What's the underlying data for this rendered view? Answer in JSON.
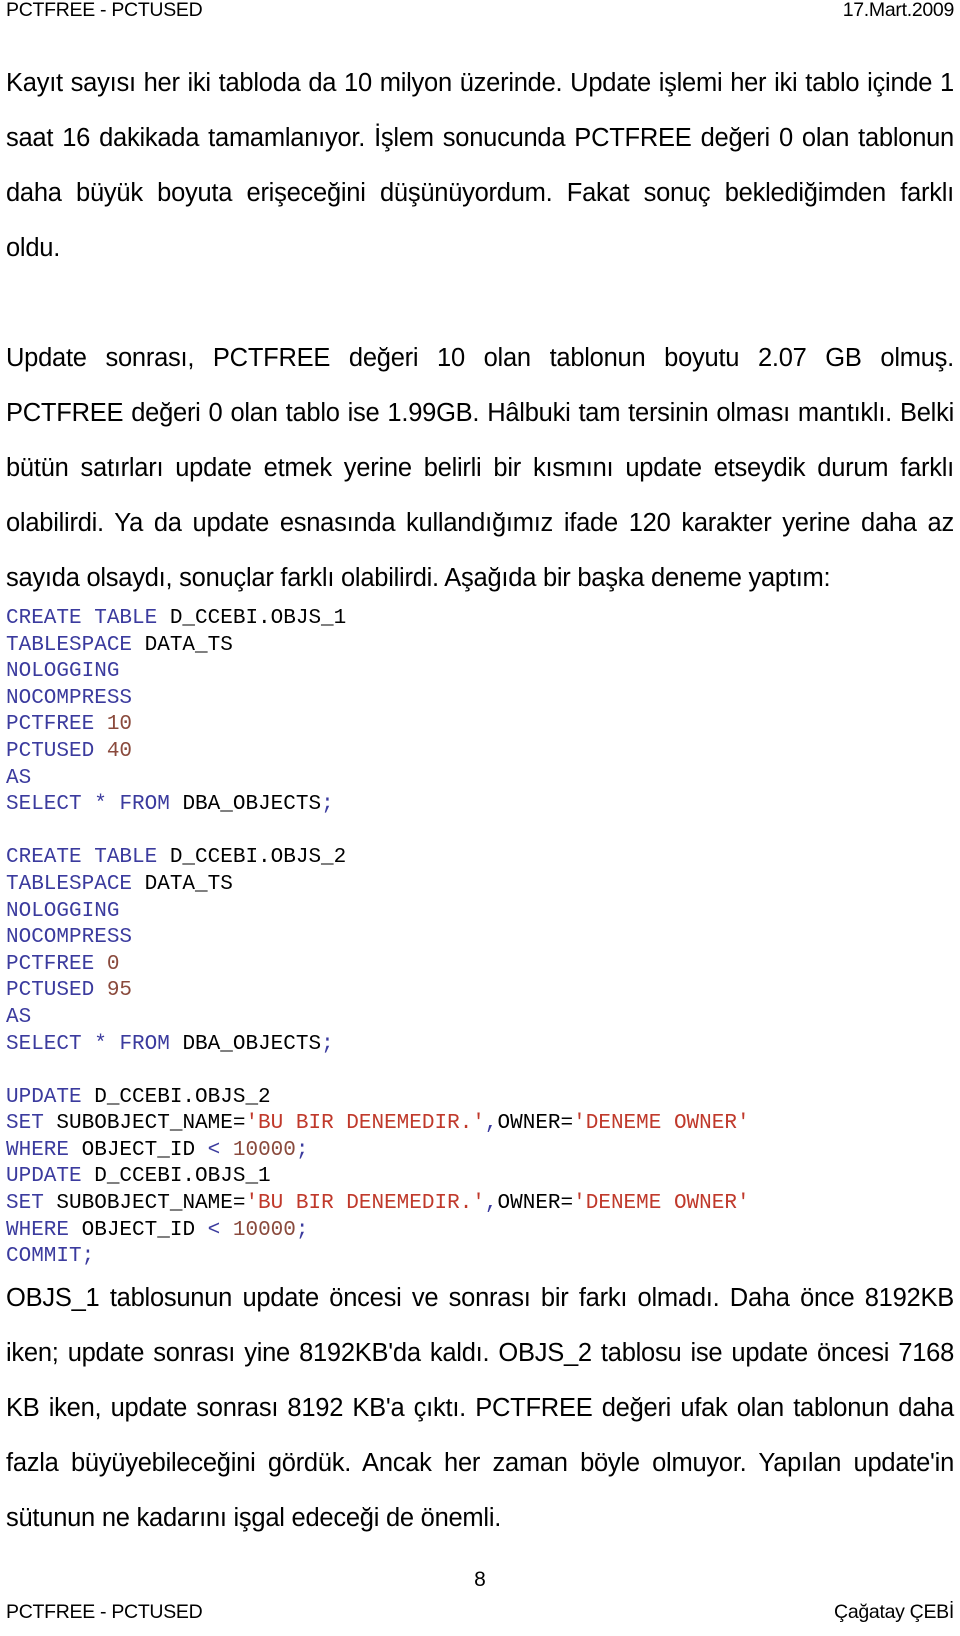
{
  "header": {
    "left": "PCTFREE - PCTUSED",
    "right": "17.Mart.2009"
  },
  "body": {
    "paragraph_1": "Kayıt sayısı her iki tabloda da 10 milyon üzerinde. Update işlemi her iki tablo içinde 1 saat 16 dakikada tamamlanıyor. İşlem sonucunda PCTFREE değeri 0 olan tablonun daha büyük boyuta erişeceğini düşünüyordum. Fakat sonuç beklediğimden farklı oldu.",
    "paragraph_2": "Update sonrası, PCTFREE değeri 10 olan tablonun boyutu 2.07 GB olmuş. PCTFREE değeri 0 olan tablo ise 1.99GB. Hâlbuki tam tersinin olması mantıklı. Belki bütün satırları update etmek yerine belirli bir kısmını update etseydik durum farklı olabilirdi.  Ya da update esnasında kullandığımız ifade 120 karakter yerine daha az sayıda olsaydı, sonuçlar farklı olabilirdi.  Aşağıda bir başka deneme yaptım:",
    "paragraph_3": "OBJS_1 tablosunun update öncesi ve sonrası bir farkı olmadı. Daha önce 8192KB iken; update sonrası yine 8192KB'da kaldı. OBJS_2 tablosu ise update öncesi 7168 KB iken, update sonrası 8192 KB'a çıktı. PCTFREE değeri ufak olan tablonun daha fazla büyüyebileceğini gördük. Ancak her zaman böyle olmuyor. Yapılan update'in sütunun ne kadarını işgal edeceği de önemli."
  },
  "code": {
    "language": "sql",
    "colors": {
      "keyword": "#3b3b9e",
      "number": "#8a4a3c",
      "string": "#c0392b",
      "plain": "#000000"
    },
    "lines": [
      [
        {
          "t": "CREATE TABLE ",
          "c": "kw"
        },
        {
          "t": "D_CCEBI.OBJS_1",
          "c": "pl"
        }
      ],
      [
        {
          "t": "TABLESPACE ",
          "c": "kw"
        },
        {
          "t": "DATA_TS",
          "c": "pl"
        }
      ],
      [
        {
          "t": "NOLOGGING",
          "c": "kw"
        }
      ],
      [
        {
          "t": "NOCOMPRESS",
          "c": "kw"
        }
      ],
      [
        {
          "t": "PCTFREE ",
          "c": "kw"
        },
        {
          "t": "10",
          "c": "num"
        }
      ],
      [
        {
          "t": "PCTUSED ",
          "c": "kw"
        },
        {
          "t": "40",
          "c": "num"
        }
      ],
      [
        {
          "t": "AS",
          "c": "kw"
        }
      ],
      [
        {
          "t": "SELECT ",
          "c": "kw"
        },
        {
          "t": "* ",
          "c": "kw"
        },
        {
          "t": "FROM ",
          "c": "kw"
        },
        {
          "t": "DBA_OBJECTS",
          "c": "pl"
        },
        {
          "t": ";",
          "c": "kw"
        }
      ],
      [],
      [
        {
          "t": "CREATE TABLE ",
          "c": "kw"
        },
        {
          "t": "D_CCEBI.OBJS_2",
          "c": "pl"
        }
      ],
      [
        {
          "t": "TABLESPACE ",
          "c": "kw"
        },
        {
          "t": "DATA_TS",
          "c": "pl"
        }
      ],
      [
        {
          "t": "NOLOGGING",
          "c": "kw"
        }
      ],
      [
        {
          "t": "NOCOMPRESS",
          "c": "kw"
        }
      ],
      [
        {
          "t": "PCTFREE ",
          "c": "kw"
        },
        {
          "t": "0",
          "c": "num"
        }
      ],
      [
        {
          "t": "PCTUSED ",
          "c": "kw"
        },
        {
          "t": "95",
          "c": "num"
        }
      ],
      [
        {
          "t": "AS",
          "c": "kw"
        }
      ],
      [
        {
          "t": "SELECT ",
          "c": "kw"
        },
        {
          "t": "* ",
          "c": "kw"
        },
        {
          "t": "FROM ",
          "c": "kw"
        },
        {
          "t": "DBA_OBJECTS",
          "c": "pl"
        },
        {
          "t": ";",
          "c": "kw"
        }
      ],
      [],
      [
        {
          "t": "UPDATE ",
          "c": "kw"
        },
        {
          "t": "D_CCEBI.OBJS_2",
          "c": "pl"
        }
      ],
      [
        {
          "t": "SET ",
          "c": "kw"
        },
        {
          "t": "SUBOBJECT_NAME=",
          "c": "pl"
        },
        {
          "t": "'BU BIR DENEMEDIR.'",
          "c": "str"
        },
        {
          "t": ",",
          "c": "kw"
        },
        {
          "t": "OWNER=",
          "c": "pl"
        },
        {
          "t": "'DENEME OWNER'",
          "c": "str"
        }
      ],
      [
        {
          "t": "WHERE ",
          "c": "kw"
        },
        {
          "t": "OBJECT_ID ",
          "c": "pl"
        },
        {
          "t": "< ",
          "c": "kw"
        },
        {
          "t": "10000",
          "c": "num"
        },
        {
          "t": ";",
          "c": "kw"
        }
      ],
      [
        {
          "t": "UPDATE ",
          "c": "kw"
        },
        {
          "t": "D_CCEBI.OBJS_1",
          "c": "pl"
        }
      ],
      [
        {
          "t": "SET ",
          "c": "kw"
        },
        {
          "t": "SUBOBJECT_NAME=",
          "c": "pl"
        },
        {
          "t": "'BU BIR DENEMEDIR.'",
          "c": "str"
        },
        {
          "t": ",",
          "c": "kw"
        },
        {
          "t": "OWNER=",
          "c": "pl"
        },
        {
          "t": "'DENEME OWNER'",
          "c": "str"
        }
      ],
      [
        {
          "t": "WHERE ",
          "c": "kw"
        },
        {
          "t": "OBJECT_ID ",
          "c": "pl"
        },
        {
          "t": "< ",
          "c": "kw"
        },
        {
          "t": "10000",
          "c": "num"
        },
        {
          "t": ";",
          "c": "kw"
        }
      ],
      [
        {
          "t": "COMMIT",
          "c": "kw"
        },
        {
          "t": ";",
          "c": "kw"
        }
      ]
    ]
  },
  "footer": {
    "left": "PCTFREE - PCTUSED",
    "page_number": "8",
    "right": "Çağatay ÇEBİ"
  }
}
